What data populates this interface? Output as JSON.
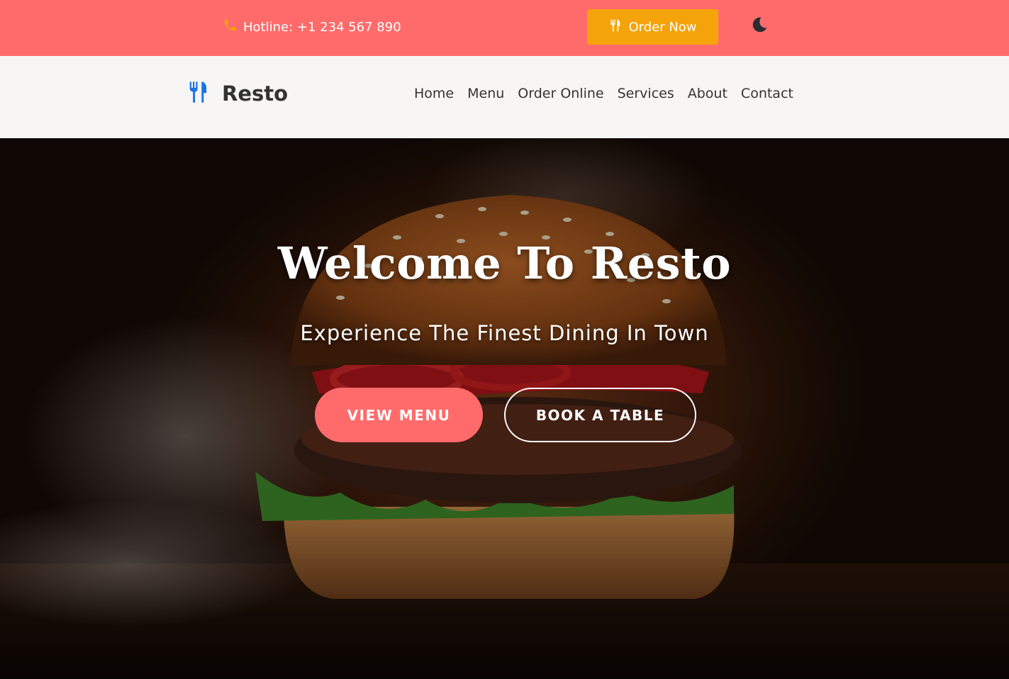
{
  "topbar": {
    "hotline": "Hotline: +1 234 567 890",
    "order_label": "Order Now",
    "theme_icon": "moon-icon"
  },
  "navbar": {
    "brand": "Resto",
    "brand_icon": "utensils-icon",
    "links": [
      {
        "label": "Home"
      },
      {
        "label": "Menu"
      },
      {
        "label": "Order Online"
      },
      {
        "label": "Services"
      },
      {
        "label": "About"
      },
      {
        "label": "Contact"
      }
    ]
  },
  "hero": {
    "title": "Welcome To Resto",
    "subtitle": "Experience The Finest Dining In Town",
    "primary_cta": "VIEW MENU",
    "secondary_cta": "BOOK A TABLE"
  },
  "colors": {
    "accent": "#ff6b6b",
    "order_button": "#f4a30a",
    "brand_icon": "#1a73e8",
    "text_dark": "#333333"
  }
}
